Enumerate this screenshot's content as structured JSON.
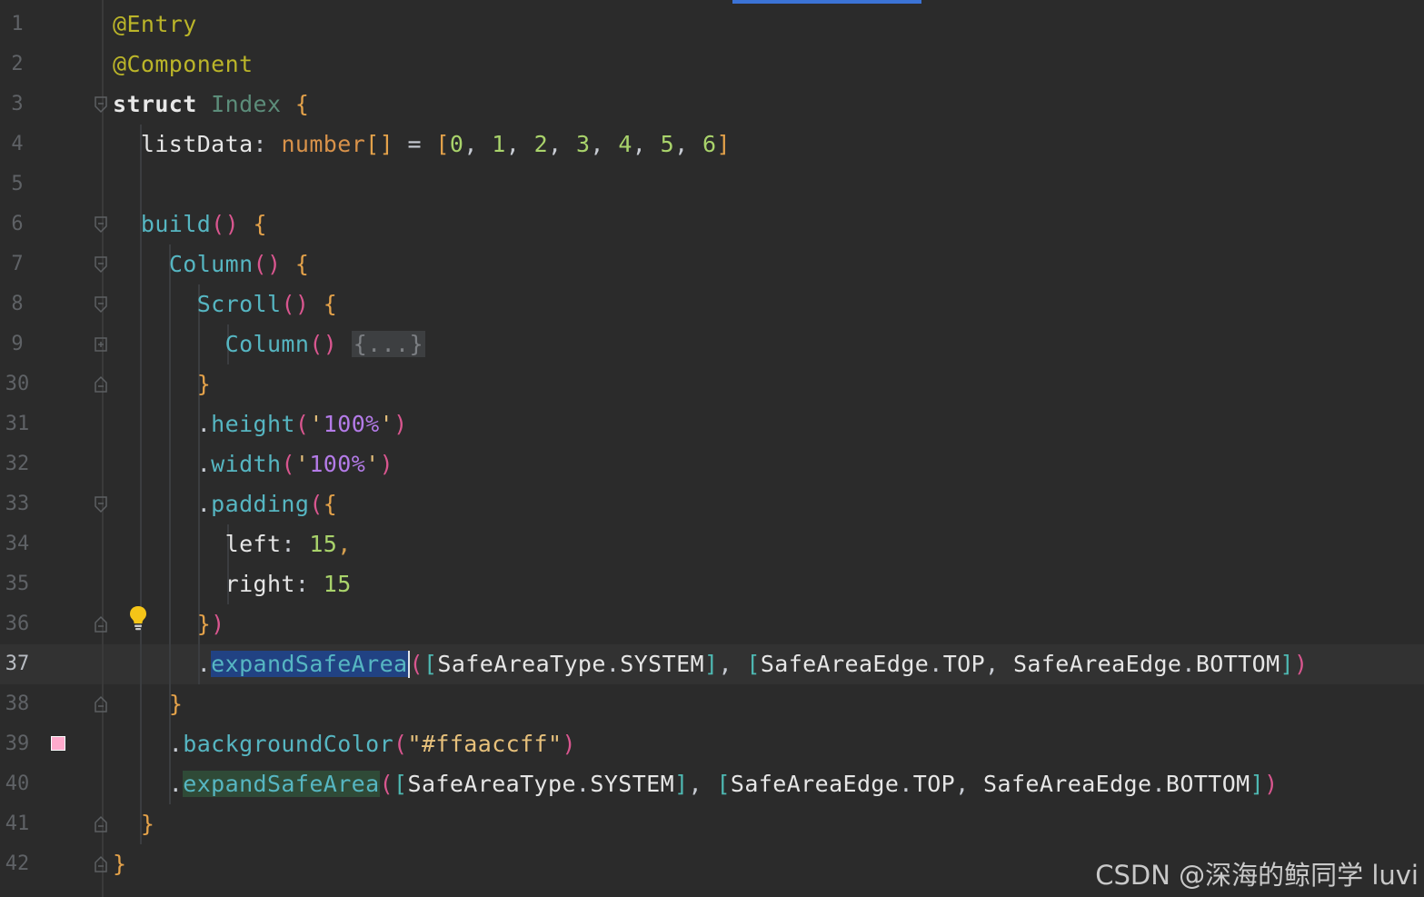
{
  "editor": {
    "theme_colors": {
      "background": "#2b2b2b",
      "current_line": "#323232",
      "selection": "#214283",
      "gutter_text": "#5f6266"
    },
    "current_line_number": "37",
    "lines": [
      {
        "n": "1",
        "tokens": [
          [
            "ann",
            "@Entry"
          ]
        ]
      },
      {
        "n": "2",
        "tokens": [
          [
            "ann",
            "@Component"
          ]
        ]
      },
      {
        "n": "3",
        "tokens": [
          [
            "kw",
            "struct"
          ],
          [
            "plain",
            " "
          ],
          [
            "cls",
            "Index"
          ],
          [
            "plain",
            " "
          ],
          [
            "brk1",
            "{"
          ]
        ]
      },
      {
        "n": "4",
        "tokens": [
          [
            "plain",
            "  "
          ],
          [
            "prop",
            "listData"
          ],
          [
            "plain",
            ": "
          ],
          [
            "type",
            "number"
          ],
          [
            "brk1",
            "[]"
          ],
          [
            "plain",
            " = "
          ],
          [
            "brk1",
            "["
          ],
          [
            "num",
            "0"
          ],
          [
            "plain",
            ", "
          ],
          [
            "num",
            "1"
          ],
          [
            "plain",
            ", "
          ],
          [
            "num",
            "2"
          ],
          [
            "plain",
            ", "
          ],
          [
            "num",
            "3"
          ],
          [
            "plain",
            ", "
          ],
          [
            "num",
            "4"
          ],
          [
            "plain",
            ", "
          ],
          [
            "num",
            "5"
          ],
          [
            "plain",
            ", "
          ],
          [
            "num",
            "6"
          ],
          [
            "brk1",
            "]"
          ]
        ]
      },
      {
        "n": "5",
        "tokens": []
      },
      {
        "n": "6",
        "tokens": [
          [
            "plain",
            "  "
          ],
          [
            "fn",
            "build"
          ],
          [
            "brk2",
            "()"
          ],
          [
            "plain",
            " "
          ],
          [
            "brk1",
            "{"
          ]
        ]
      },
      {
        "n": "7",
        "tokens": [
          [
            "plain",
            "    "
          ],
          [
            "fn",
            "Column"
          ],
          [
            "brk2",
            "()"
          ],
          [
            "plain",
            " "
          ],
          [
            "brk1",
            "{"
          ]
        ]
      },
      {
        "n": "8",
        "tokens": [
          [
            "plain",
            "      "
          ],
          [
            "fn",
            "Scroll"
          ],
          [
            "brk2",
            "()"
          ],
          [
            "plain",
            " "
          ],
          [
            "brk1",
            "{"
          ]
        ]
      },
      {
        "n": "9",
        "tokens": [
          [
            "plain",
            "        "
          ],
          [
            "fn",
            "Column"
          ],
          [
            "brk2",
            "()"
          ],
          [
            "plain",
            " "
          ],
          [
            "folded",
            "{...}"
          ]
        ]
      },
      {
        "n": "30",
        "tokens": [
          [
            "plain",
            "      "
          ],
          [
            "brk1",
            "}"
          ]
        ]
      },
      {
        "n": "31",
        "tokens": [
          [
            "plain",
            "      ."
          ],
          [
            "fn",
            "height"
          ],
          [
            "brk2",
            "("
          ],
          [
            "strq",
            "'"
          ],
          [
            "str",
            "100%"
          ],
          [
            "strq",
            "'"
          ],
          [
            "brk2",
            ")"
          ]
        ]
      },
      {
        "n": "32",
        "tokens": [
          [
            "plain",
            "      ."
          ],
          [
            "fn",
            "width"
          ],
          [
            "brk2",
            "("
          ],
          [
            "strq",
            "'"
          ],
          [
            "str",
            "100%"
          ],
          [
            "strq",
            "'"
          ],
          [
            "brk2",
            ")"
          ]
        ]
      },
      {
        "n": "33",
        "tokens": [
          [
            "plain",
            "      ."
          ],
          [
            "fn",
            "padding"
          ],
          [
            "brk2",
            "("
          ],
          [
            "brk1",
            "{"
          ]
        ]
      },
      {
        "n": "34",
        "tokens": [
          [
            "plain",
            "        "
          ],
          [
            "prop",
            "left"
          ],
          [
            "plain",
            ": "
          ],
          [
            "num",
            "15"
          ],
          [
            "punc",
            ","
          ]
        ]
      },
      {
        "n": "35",
        "tokens": [
          [
            "plain",
            "        "
          ],
          [
            "prop",
            "right"
          ],
          [
            "plain",
            ": "
          ],
          [
            "num",
            "15"
          ]
        ]
      },
      {
        "n": "36",
        "tokens": [
          [
            "plain",
            "      "
          ],
          [
            "brk1",
            "}"
          ],
          [
            "brk2",
            ")"
          ]
        ]
      },
      {
        "n": "37",
        "tokens": [
          [
            "plain",
            "      ."
          ],
          [
            "sel",
            "expandSafeArea"
          ],
          [
            "caret",
            ""
          ],
          [
            "brk2",
            "("
          ],
          [
            "brk3",
            "["
          ],
          [
            "prop",
            "SafeAreaType"
          ],
          [
            "plain",
            "."
          ],
          [
            "prop",
            "SYSTEM"
          ],
          [
            "brk3",
            "]"
          ],
          [
            "plain",
            ", "
          ],
          [
            "brk3",
            "["
          ],
          [
            "prop",
            "SafeAreaEdge"
          ],
          [
            "plain",
            "."
          ],
          [
            "prop",
            "TOP"
          ],
          [
            "plain",
            ", "
          ],
          [
            "prop",
            "SafeAreaEdge"
          ],
          [
            "plain",
            "."
          ],
          [
            "prop",
            "BOTTOM"
          ],
          [
            "brk3",
            "]"
          ],
          [
            "brk2",
            ")"
          ]
        ]
      },
      {
        "n": "38",
        "tokens": [
          [
            "plain",
            "    "
          ],
          [
            "brk1",
            "}"
          ]
        ]
      },
      {
        "n": "39",
        "tokens": [
          [
            "plain",
            "    ."
          ],
          [
            "fn",
            "backgroundColor"
          ],
          [
            "brk2",
            "("
          ],
          [
            "strq",
            "\"#ffaaccff\""
          ],
          [
            "brk2",
            ")"
          ]
        ]
      },
      {
        "n": "40",
        "tokens": [
          [
            "plain",
            "    ."
          ],
          [
            "hlfn",
            "expandSafeArea"
          ],
          [
            "brk2",
            "("
          ],
          [
            "brk3",
            "["
          ],
          [
            "prop",
            "SafeAreaType"
          ],
          [
            "plain",
            "."
          ],
          [
            "prop",
            "SYSTEM"
          ],
          [
            "brk3",
            "]"
          ],
          [
            "plain",
            ", "
          ],
          [
            "brk3",
            "["
          ],
          [
            "prop",
            "SafeAreaEdge"
          ],
          [
            "plain",
            "."
          ],
          [
            "prop",
            "TOP"
          ],
          [
            "plain",
            ", "
          ],
          [
            "prop",
            "SafeAreaEdge"
          ],
          [
            "plain",
            "."
          ],
          [
            "prop",
            "BOTTOM"
          ],
          [
            "brk3",
            "]"
          ],
          [
            "brk2",
            ")"
          ]
        ]
      },
      {
        "n": "41",
        "tokens": [
          [
            "plain",
            "  "
          ],
          [
            "brk1",
            "}"
          ]
        ]
      },
      {
        "n": "42",
        "tokens": [
          [
            "brk1",
            "}"
          ]
        ]
      }
    ],
    "fold_markers": {
      "3": "open",
      "6": "open",
      "7": "open",
      "8": "open",
      "9": "collapsed",
      "30": "close",
      "33": "open",
      "36": "close",
      "38": "close",
      "41": "close",
      "42": "close"
    },
    "indent_guides": {
      "4": [
        1
      ],
      "5": [
        1
      ],
      "6": [
        1
      ],
      "7": [
        1,
        2
      ],
      "8": [
        1,
        2,
        3
      ],
      "9": [
        1,
        2,
        3,
        4
      ],
      "30": [
        1,
        2,
        3
      ],
      "31": [
        1,
        2,
        3
      ],
      "32": [
        1,
        2,
        3
      ],
      "33": [
        1,
        2,
        3
      ],
      "34": [
        1,
        2,
        3,
        4
      ],
      "35": [
        1,
        2,
        3,
        4
      ],
      "36": [
        1,
        2,
        3
      ],
      "37": [
        1,
        2,
        3
      ],
      "38": [
        1,
        2
      ],
      "39": [
        1,
        2
      ],
      "40": [
        1,
        2
      ],
      "41": [
        1
      ]
    },
    "intention_bulb_line": "36",
    "color_swatch_line": "39",
    "color_swatch_value": "#ffaacc"
  },
  "watermark": {
    "text": "CSDN @深海的鲸同学 luvi"
  }
}
